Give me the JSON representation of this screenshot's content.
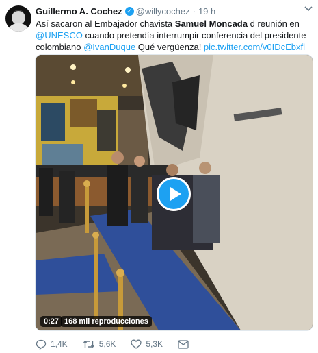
{
  "tweet": {
    "author_name": "Guillermo A. Cochez",
    "handle": "@willycochez",
    "separator": "·",
    "time": "19 h",
    "text_segments": {
      "t1": "Así sacaron al Embajador chavista ",
      "t2": "Samuel Moncada",
      "t3": " d reunión en ",
      "t4": "@UNESCO",
      "t5": " cuando pretendía interrumpir conferencia del presidente colombiano ",
      "t6": "@IvanDuque",
      "t7": " Qué vergüenza! ",
      "t8": "pic.twitter.com/v0IDcEbxfl"
    },
    "video": {
      "duration": "0:27",
      "views": "168 mil reproducciones"
    },
    "actions": {
      "replies": "1,4K",
      "retweets": "5,6K",
      "likes": "5,3K"
    },
    "colors": {
      "accent": "#1da1f2",
      "text": "#14171a",
      "muted": "#657786"
    },
    "icons": [
      "verified-badge-icon",
      "caret-down-icon",
      "play-icon",
      "reply-icon",
      "retweet-icon",
      "like-icon",
      "direct-message-icon"
    ]
  }
}
